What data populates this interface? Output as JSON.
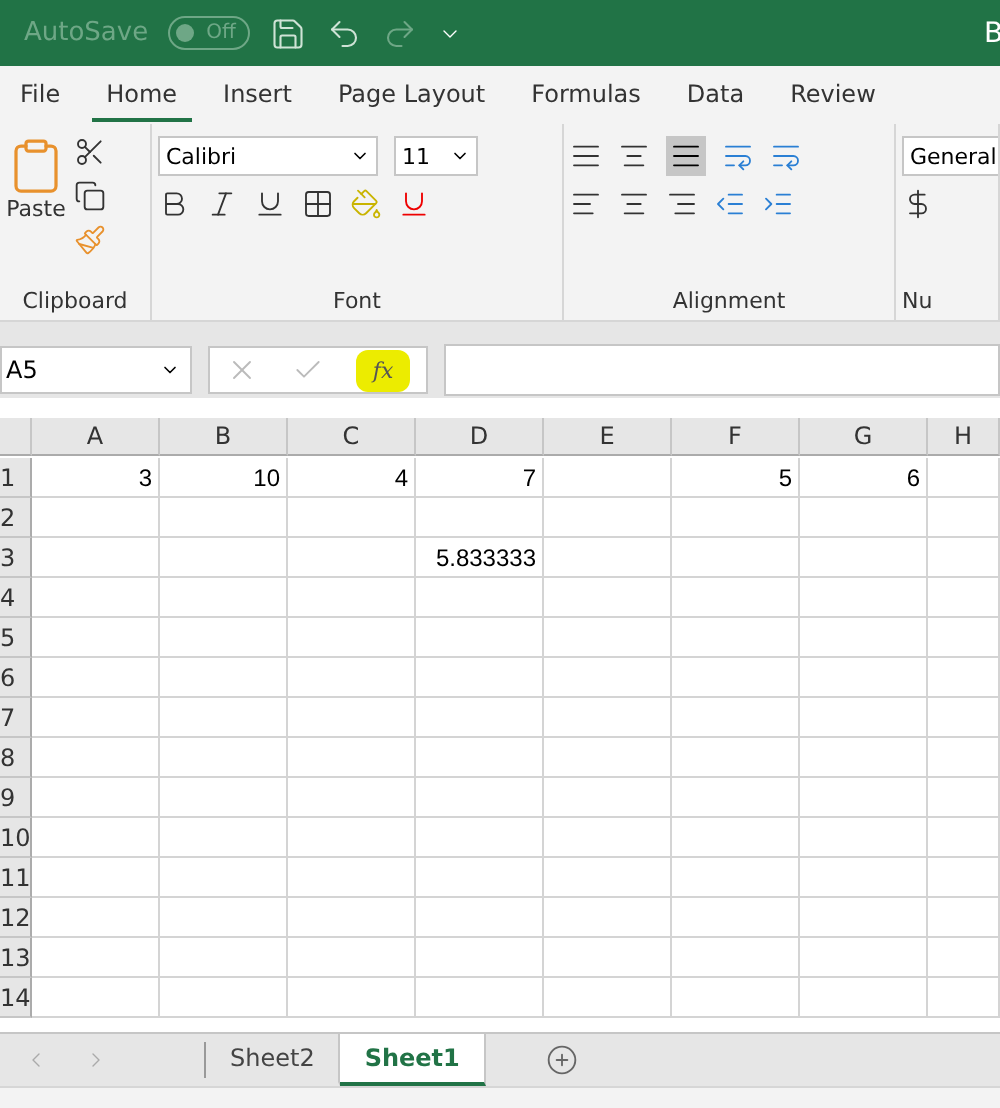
{
  "title_bar": {
    "autosave_label": "AutoSave",
    "autosave_toggle": {
      "label": "Off",
      "on": false
    },
    "title_partial": "B"
  },
  "tabs": [
    {
      "label": "File",
      "selected": false
    },
    {
      "label": "Home",
      "selected": true
    },
    {
      "label": "Insert",
      "selected": false
    },
    {
      "label": "Page Layout",
      "selected": false
    },
    {
      "label": "Formulas",
      "selected": false
    },
    {
      "label": "Data",
      "selected": false
    },
    {
      "label": "Review",
      "selected": false
    }
  ],
  "ribbon": {
    "clipboard": {
      "paste_label": "Paste",
      "group_label": "Clipboard"
    },
    "font": {
      "font_name": "Calibri",
      "font_size": "11",
      "group_label": "Font"
    },
    "alignment": {
      "group_label": "Alignment",
      "bottom_align_selected": true
    },
    "number": {
      "format": "General",
      "group_label_partial": "Nu"
    }
  },
  "formula_bar": {
    "name_box": "A5",
    "fx_label": "fx",
    "fx_highlighted": true
  },
  "columns": [
    "A",
    "B",
    "C",
    "D",
    "E",
    "F",
    "G",
    "H"
  ],
  "rows": [
    {
      "label": "1",
      "cells": [
        "3",
        "10",
        "4",
        "7",
        null,
        "5",
        "6",
        null
      ]
    },
    {
      "label": "2",
      "cells": []
    },
    {
      "label": "3",
      "cells": [
        null,
        null,
        null,
        "5.833333"
      ]
    },
    {
      "label": "4",
      "cells": []
    },
    {
      "label": "5",
      "cells": []
    },
    {
      "label": "6",
      "cells": []
    },
    {
      "label": "7",
      "cells": []
    },
    {
      "label": "8",
      "cells": []
    },
    {
      "label": "9",
      "cells": []
    },
    {
      "label": "10",
      "cells": []
    },
    {
      "label": "11",
      "cells": []
    },
    {
      "label": "12",
      "cells": []
    },
    {
      "label": "13",
      "cells": []
    },
    {
      "label": "14",
      "cells": []
    }
  ],
  "sheet_tabs": [
    {
      "label": "Sheet2",
      "selected": false
    },
    {
      "label": "Sheet1",
      "selected": true
    }
  ]
}
